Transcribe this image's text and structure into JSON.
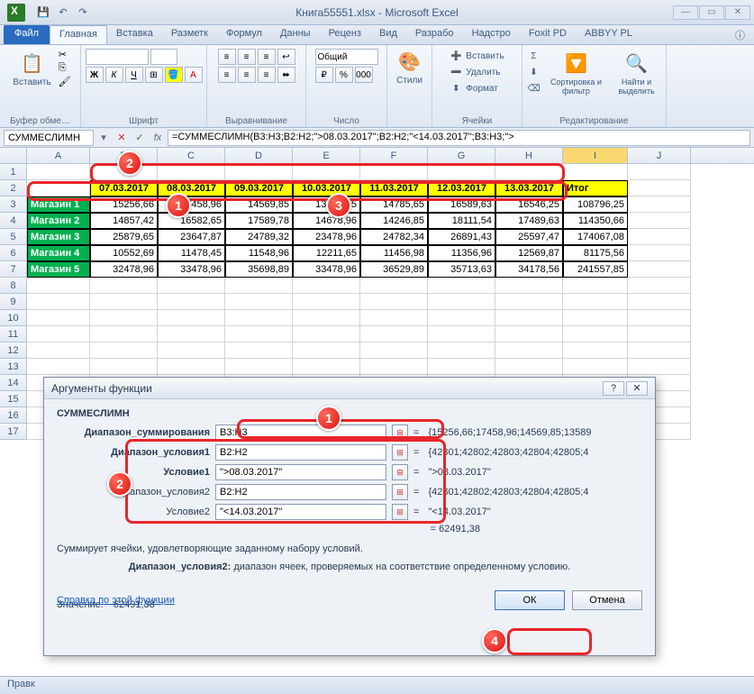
{
  "title": "Книга55551.xlsx - Microsoft Excel",
  "tabs": {
    "file": "Файл",
    "home": "Главная",
    "insert": "Вставка",
    "layout": "Разметк",
    "formulas": "Формул",
    "data": "Данны",
    "review": "Реценз",
    "view": "Вид",
    "dev": "Разрабо",
    "addins": "Надстро",
    "foxit": "Foxit PD",
    "abbyy": "ABBYY PL"
  },
  "ribbon": {
    "paste": "Вставить",
    "clipboard": "Буфер обме…",
    "font_group": "Шрифт",
    "align_group": "Выравнивание",
    "number_group": "Число",
    "general": "Общий",
    "styles": "Стили",
    "cells_group": "Ячейки",
    "cells_insert": "Вставить",
    "cells_delete": "Удалить",
    "cells_format": "Формат",
    "edit_group": "Редактирование",
    "sort": "Сортировка и фильтр",
    "find": "Найти и выделить"
  },
  "namebox": "СУММЕСЛИМН",
  "formula": "=СУММЕСЛИМН(B3:H3;B2:H2;\">08.03.2017\";B2:H2;\"<14.03.2017\";B3:H3;\">",
  "cols": [
    "A",
    "B",
    "C",
    "D",
    "E",
    "F",
    "G",
    "H",
    "I",
    "J"
  ],
  "rows_h": [
    "1",
    "2",
    "3",
    "4",
    "5",
    "6",
    "7",
    "8",
    "9",
    "10",
    "11",
    "12",
    "13",
    "14",
    "15",
    "16",
    "17"
  ],
  "dates": [
    "07.03.2017",
    "08.03.2017",
    "09.03.2017",
    "10.03.2017",
    "11.03.2017",
    "12.03.2017",
    "13.03.2017"
  ],
  "itog": "Итог",
  "shops": [
    "Магазин 1",
    "Магазин 2",
    "Магазин 3",
    "Магазин 4",
    "Магазин 5"
  ],
  "data": [
    [
      "15256,66",
      "17458,96",
      "14569,85",
      "13589,25",
      "14785,65",
      "16589,63",
      "16546,25",
      "108796,25"
    ],
    [
      "14857,42",
      "16582,65",
      "17589,78",
      "14678,96",
      "14246,85",
      "18111,54",
      "17489,63",
      "114350,66"
    ],
    [
      "25879,65",
      "23647,87",
      "24789,32",
      "23478,96",
      "24782,34",
      "26891,43",
      "25597,47",
      "174067,08"
    ],
    [
      "10552,69",
      "11478,45",
      "11548,96",
      "12211,65",
      "11456,98",
      "11356,96",
      "12569,87",
      "81175,56"
    ],
    [
      "32478,96",
      "33478,96",
      "35698,89",
      "33478,96",
      "36529,89",
      "35713,63",
      "34178,56",
      "241557,85"
    ]
  ],
  "dialog": {
    "title": "Аргументы функции",
    "func": "СУММЕСЛИМН",
    "args": [
      {
        "label": "Диапазон_суммирования",
        "bold": true,
        "value": "B3:H3",
        "result": "{15256,66;17458,96;14569,85;13589"
      },
      {
        "label": "Диапазон_условия1",
        "bold": true,
        "value": "B2:H2",
        "result": "{42801;42802;42803;42804;42805;4"
      },
      {
        "label": "Условие1",
        "bold": true,
        "value": "\">08.03.2017\"",
        "result": "\">08.03.2017\""
      },
      {
        "label": "Диапазон_условия2",
        "bold": false,
        "value": "B2:H2",
        "result": "{42801;42802;42803;42804;42805;4"
      },
      {
        "label": "Условие2",
        "bold": false,
        "value": "\"<14.03.2017\"",
        "result": "\"<14.03.2017\""
      }
    ],
    "total_result": "= 62491,38",
    "desc1": "Суммирует ячейки, удовлетворяющие заданному набору условий.",
    "desc_label": "Диапазон_условия2:",
    "desc_text": "диапазон ячеек, проверяемых на соответствие определенному условию.",
    "value_label": "Значение:",
    "value": "62491,38",
    "help_link": "Справка по этой функции",
    "ok": "ОК",
    "cancel": "Отмена"
  },
  "status": "Правк"
}
